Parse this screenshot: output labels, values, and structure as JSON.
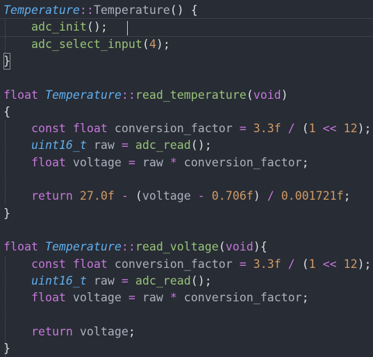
{
  "colors": {
    "background": "#282c34",
    "plain": "#abb2bf",
    "keyword": "#c678dd",
    "type": "#61afef",
    "class_name": "#61afef",
    "function": "#98c379",
    "number": "#d19a66",
    "operator": "#c678dd",
    "punct": "#dcdfe4"
  },
  "editor": {
    "lines": [
      [
        [
          "class",
          "Temperature"
        ],
        [
          "op",
          "::"
        ],
        [
          "plain",
          "Temperature"
        ],
        [
          "punct",
          "() {"
        ]
      ],
      [
        [
          "indent",
          "    "
        ],
        [
          "fn",
          "adc_init"
        ],
        [
          "punct",
          "();"
        ]
      ],
      [
        [
          "indent",
          "    "
        ],
        [
          "fn",
          "adc_select_input"
        ],
        [
          "punct",
          "("
        ],
        [
          "num",
          "4"
        ],
        [
          "punct",
          ");"
        ]
      ],
      [
        [
          "punct",
          "}"
        ]
      ],
      [],
      [
        [
          "kw",
          "float "
        ],
        [
          "class",
          "Temperature"
        ],
        [
          "op",
          "::"
        ],
        [
          "fn",
          "read_temperature"
        ],
        [
          "punct",
          "("
        ],
        [
          "kw",
          "void"
        ],
        [
          "punct",
          ")"
        ]
      ],
      [
        [
          "punct",
          "{"
        ]
      ],
      [
        [
          "indent",
          "    "
        ],
        [
          "kw",
          "const float "
        ],
        [
          "plain",
          "conversion_factor "
        ],
        [
          "op",
          "= "
        ],
        [
          "num",
          "3.3f "
        ],
        [
          "op",
          "/ "
        ],
        [
          "punct",
          "("
        ],
        [
          "num",
          "1 "
        ],
        [
          "op",
          "<< "
        ],
        [
          "num",
          "12"
        ],
        [
          "punct",
          ");"
        ]
      ],
      [
        [
          "indent",
          "    "
        ],
        [
          "type",
          "uint16_t"
        ],
        [
          "plain",
          " raw "
        ],
        [
          "op",
          "= "
        ],
        [
          "fn",
          "adc_read"
        ],
        [
          "punct",
          "();"
        ]
      ],
      [
        [
          "indent",
          "    "
        ],
        [
          "kw",
          "float "
        ],
        [
          "plain",
          "voltage "
        ],
        [
          "op",
          "= "
        ],
        [
          "plain",
          "raw "
        ],
        [
          "op",
          "* "
        ],
        [
          "plain",
          "conversion_factor"
        ],
        [
          "punct",
          ";"
        ]
      ],
      [],
      [
        [
          "indent",
          "    "
        ],
        [
          "kw",
          "return "
        ],
        [
          "num",
          "27.0f "
        ],
        [
          "op",
          "- "
        ],
        [
          "punct",
          "("
        ],
        [
          "plain",
          "voltage "
        ],
        [
          "op",
          "- "
        ],
        [
          "num",
          "0.706f"
        ],
        [
          "punct",
          ") "
        ],
        [
          "op",
          "/ "
        ],
        [
          "num",
          "0.001721f"
        ],
        [
          "punct",
          ";"
        ]
      ],
      [
        [
          "punct",
          "}"
        ]
      ],
      [],
      [
        [
          "kw",
          "float "
        ],
        [
          "class",
          "Temperature"
        ],
        [
          "op",
          "::"
        ],
        [
          "fn",
          "read_voltage"
        ],
        [
          "punct",
          "("
        ],
        [
          "kw",
          "void"
        ],
        [
          "punct",
          "){"
        ]
      ],
      [
        [
          "indent",
          "    "
        ],
        [
          "kw",
          "const float "
        ],
        [
          "plain",
          "conversion_factor "
        ],
        [
          "op",
          "= "
        ],
        [
          "num",
          "3.3f "
        ],
        [
          "op",
          "/ "
        ],
        [
          "punct",
          "("
        ],
        [
          "num",
          "1 "
        ],
        [
          "op",
          "<< "
        ],
        [
          "num",
          "12"
        ],
        [
          "punct",
          ");"
        ]
      ],
      [
        [
          "indent",
          "    "
        ],
        [
          "type",
          "uint16_t"
        ],
        [
          "plain",
          " raw "
        ],
        [
          "op",
          "= "
        ],
        [
          "fn",
          "adc_read"
        ],
        [
          "punct",
          "();"
        ]
      ],
      [
        [
          "indent",
          "    "
        ],
        [
          "kw",
          "float "
        ],
        [
          "plain",
          "voltage "
        ],
        [
          "op",
          "= "
        ],
        [
          "plain",
          "raw "
        ],
        [
          "op",
          "* "
        ],
        [
          "plain",
          "conversion_factor"
        ],
        [
          "punct",
          ";"
        ]
      ],
      [],
      [
        [
          "indent",
          "    "
        ],
        [
          "kw",
          "return "
        ],
        [
          "plain",
          "voltage"
        ],
        [
          "punct",
          ";"
        ]
      ],
      [
        [
          "punct",
          "}"
        ]
      ]
    ]
  }
}
